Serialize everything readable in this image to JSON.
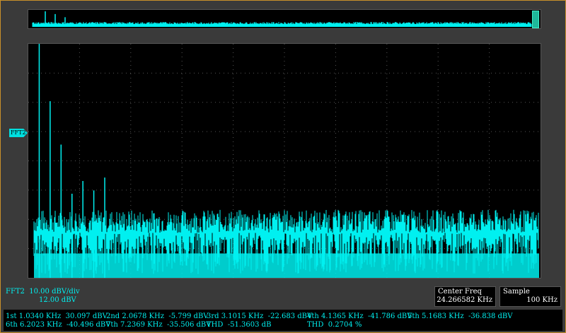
{
  "channel": {
    "label": "FFT2",
    "scale": "FFT2  10.00 dBV/div",
    "offset": "12.00 dBV"
  },
  "center_freq": {
    "title": "Center Freq",
    "value": "24.266582 KHz"
  },
  "sample": {
    "title": "Sample",
    "value": "100 KHz"
  },
  "measurements": {
    "row1": [
      "1st 1.0340 KHz  30.097 dBV",
      "2nd 2.0678 KHz  -5.799 dBV",
      "3rd 3.1015 KHz  -22.683 dBV",
      "4th 4.1365 KHz  -41.786 dBV",
      "5th 5.1683 KHz  -36.838 dBV"
    ],
    "row2": [
      "6th 6.2023 KHz  -40.496 dBV",
      "7th 7.2369 KHz  -35.506 dBV",
      "THD  -51.3603 dB",
      "THD  0.2704 %"
    ]
  },
  "colors": {
    "trace": "#00f0f0",
    "frame": "#c8902a",
    "background": "#3a3a3a"
  },
  "chart_data": {
    "type": "line",
    "title": "",
    "xlabel": "",
    "ylabel": "",
    "ylim_relative_dbv": [
      -74.5,
      16.5
    ],
    "x_unit": "KHz",
    "xlim": [
      0,
      48.5
    ],
    "harmonics_x": [
      1.034,
      2.0678,
      3.1015,
      4.1365,
      5.1683,
      6.2023,
      7.2369
    ],
    "harmonics_y": [
      30.097,
      -5.799,
      -22.683,
      -41.786,
      -36.838,
      -40.496,
      -35.506
    ],
    "noise_floor_dbv": -55
  }
}
